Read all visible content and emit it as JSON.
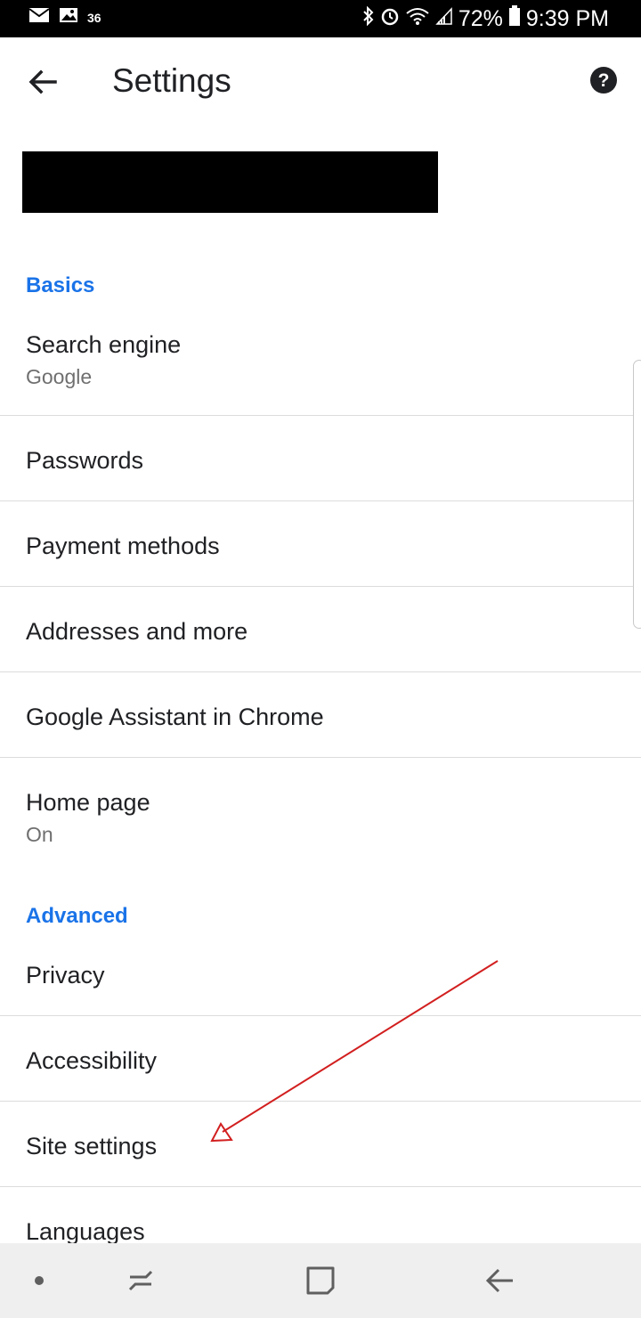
{
  "status_bar": {
    "temperature": "36",
    "battery": "72%",
    "time": "9:39 PM",
    "left_icons": [
      "mail-icon",
      "image-icon"
    ],
    "right_icons": [
      "bluetooth-icon",
      "alarm-icon",
      "wifi-icon",
      "signal-icon",
      "battery-icon"
    ]
  },
  "toolbar": {
    "title": "Settings",
    "back_icon": "arrow-back-icon",
    "help_icon": "help-icon"
  },
  "sections": [
    {
      "header": "Basics",
      "items": [
        {
          "label": "Search engine",
          "sub": "Google"
        },
        {
          "label": "Passwords"
        },
        {
          "label": "Payment methods"
        },
        {
          "label": "Addresses and more"
        },
        {
          "label": "Google Assistant in Chrome"
        },
        {
          "label": "Home page",
          "sub": "On"
        }
      ]
    },
    {
      "header": "Advanced",
      "items": [
        {
          "label": "Privacy"
        },
        {
          "label": "Accessibility"
        },
        {
          "label": "Site settings"
        },
        {
          "label": "Languages"
        }
      ]
    }
  ],
  "colors": {
    "accent": "#1a73e8",
    "annotation_arrow": "#d21f1f"
  },
  "nav_bar": {
    "icons": [
      "dot-icon",
      "recents-icon",
      "home-icon",
      "back-icon"
    ]
  }
}
